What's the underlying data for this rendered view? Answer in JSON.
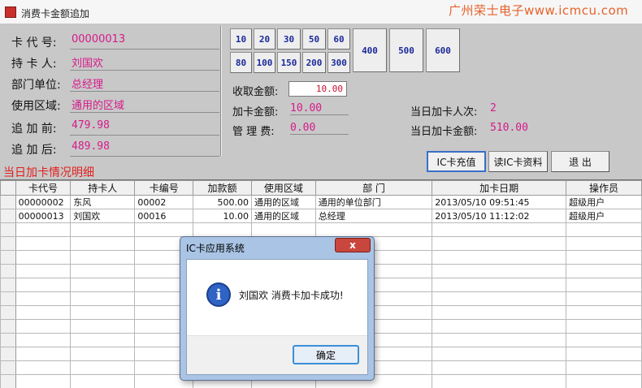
{
  "window": {
    "title": "消费卡金额追加",
    "watermark": "广州荣士电子www.icmcu.com"
  },
  "card": {
    "code_label": "卡 代 号:",
    "code": "00000013",
    "holder_label": "持 卡 人:",
    "holder": "刘国欢",
    "dept_label": "部门单位:",
    "dept": "总经理",
    "area_label": "使用区域:",
    "area": "通用的区域",
    "before_label": "追 加 前:",
    "before": "479.98",
    "after_label": "追 加 后:",
    "after": "489.98"
  },
  "amounts": {
    "small": [
      "10",
      "20",
      "30",
      "50",
      "60",
      "80",
      "100",
      "150",
      "200",
      "300"
    ],
    "big": [
      "400",
      "500",
      "600"
    ]
  },
  "money": {
    "collect_label": "收取金额:",
    "collect": "10.00",
    "add_label": "加卡金额:",
    "add": "10.00",
    "fee_label": "管 理 费:",
    "fee": "0.00"
  },
  "stats": {
    "count_label": "当日加卡人次:",
    "count": "2",
    "amount_label": "当日加卡金额:",
    "amount": "510.00"
  },
  "buttons": {
    "recharge": "IC卡充值",
    "read": "读IC卡资料",
    "exit": "退  出"
  },
  "section_title": "当日加卡情况明细",
  "table": {
    "headers": [
      "卡代号",
      "持卡人",
      "卡编号",
      "加款额",
      "使用区域",
      "部  门",
      "加卡日期",
      "操作员"
    ],
    "rows": [
      [
        "00000002",
        "东风",
        "00002",
        "500.00",
        "通用的区域",
        "通用的单位部门",
        "2013/05/10 09:51:45",
        "超级用户"
      ],
      [
        "00000013",
        "刘国欢",
        "00016",
        "10.00",
        "通用的区域",
        "总经理",
        "2013/05/10 11:12:02",
        "超级用户"
      ]
    ]
  },
  "dialog": {
    "title": "IC卡应用系统",
    "message": "刘国欢 消费卡加卡成功!",
    "ok": "确定",
    "close": "x"
  }
}
